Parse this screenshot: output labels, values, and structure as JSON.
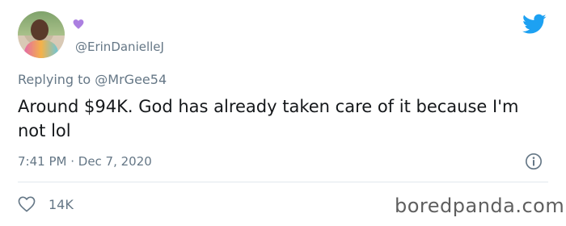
{
  "tweet": {
    "author_handle": "@ErinDanielleJ",
    "replying_prefix": "Replying to",
    "replying_to": "@MrGee54",
    "text": "Around $94K. God has already taken care of it because I'm not lol",
    "time": "7:41 PM",
    "separator": " · ",
    "date": "Dec 7, 2020",
    "likes": "14K"
  },
  "icons": {
    "avatar": "avatar",
    "heart_badge": "purple-heart-icon",
    "brand": "twitter-bird-icon",
    "info": "info-icon",
    "like": "heart-outline-icon"
  },
  "colors": {
    "brand_blue": "#1da1f2",
    "muted_text": "#657786",
    "heart_purple": "#ab7fe0"
  },
  "watermark": "boredpanda.com"
}
